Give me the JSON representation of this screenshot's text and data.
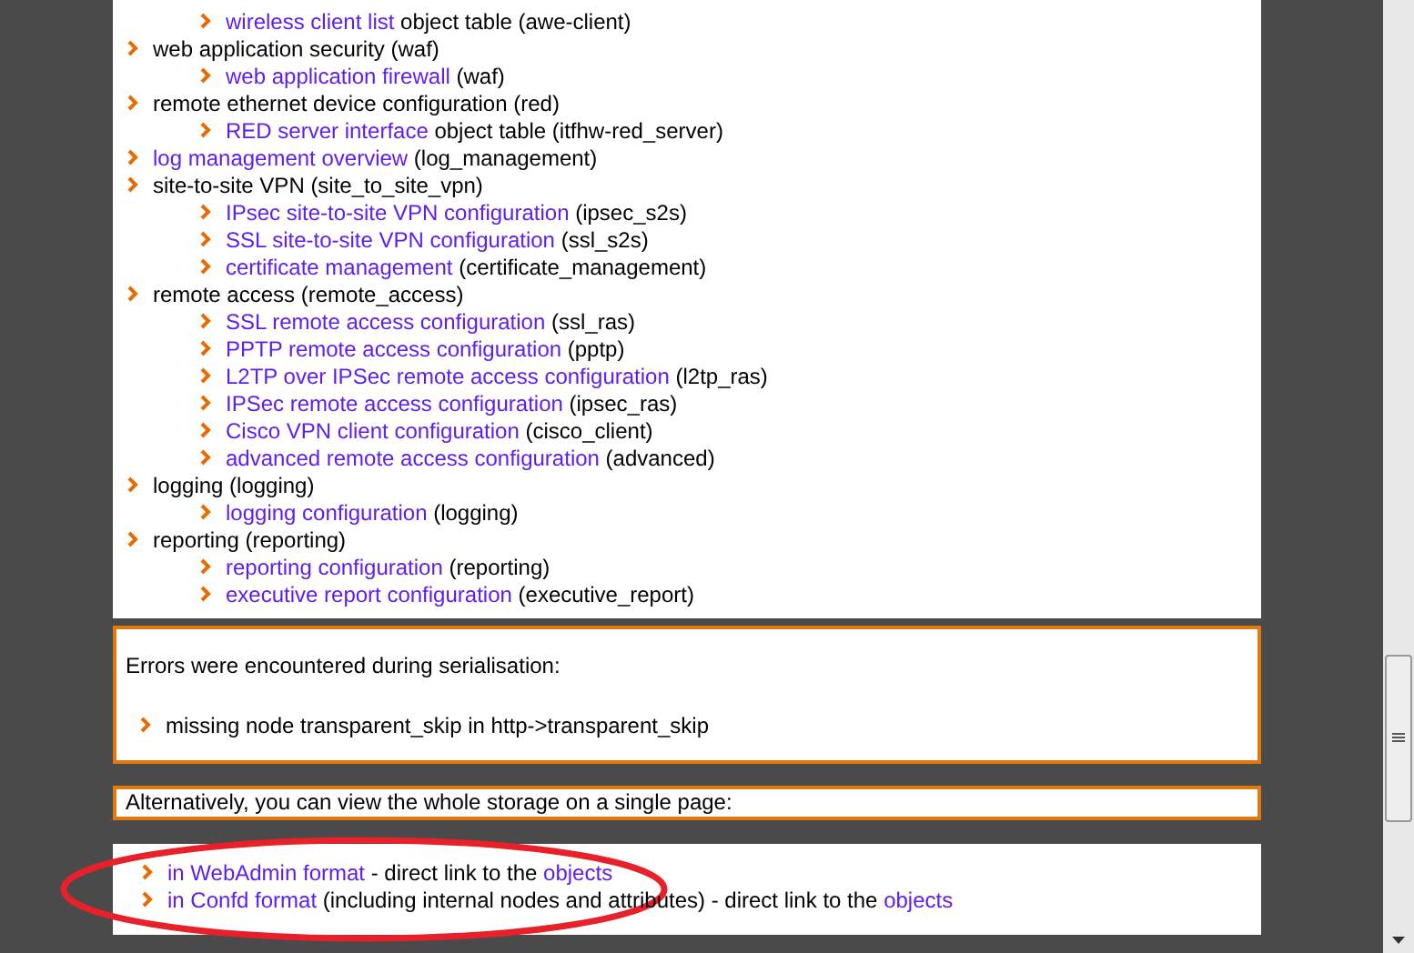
{
  "tree_continued": [
    {
      "parts": [
        {
          "kind": "link",
          "text": "wireless client list"
        },
        {
          "kind": "plain",
          "text": " object table (awe-client)"
        }
      ]
    }
  ],
  "tree": [
    {
      "parts": [
        {
          "kind": "plain",
          "text": "web application security (waf)"
        }
      ],
      "children": [
        {
          "parts": [
            {
              "kind": "link",
              "text": "web application firewall"
            },
            {
              "kind": "plain",
              "text": " (waf)"
            }
          ]
        }
      ]
    },
    {
      "parts": [
        {
          "kind": "plain",
          "text": "remote ethernet device configuration (red)"
        }
      ],
      "children": [
        {
          "parts": [
            {
              "kind": "link",
              "text": "RED server interface"
            },
            {
              "kind": "plain",
              "text": " object table (itfhw-red_server)"
            }
          ]
        }
      ]
    },
    {
      "parts": [
        {
          "kind": "link",
          "text": "log management overview"
        },
        {
          "kind": "plain",
          "text": " (log_management)"
        }
      ]
    },
    {
      "parts": [
        {
          "kind": "plain",
          "text": "site-to-site VPN (site_to_site_vpn)"
        }
      ],
      "children": [
        {
          "parts": [
            {
              "kind": "link",
              "text": "IPsec site-to-site VPN configuration"
            },
            {
              "kind": "plain",
              "text": " (ipsec_s2s)"
            }
          ]
        },
        {
          "parts": [
            {
              "kind": "link",
              "text": "SSL site-to-site VPN configuration"
            },
            {
              "kind": "plain",
              "text": " (ssl_s2s)"
            }
          ]
        },
        {
          "parts": [
            {
              "kind": "link",
              "text": "certificate management"
            },
            {
              "kind": "plain",
              "text": " (certificate_management)"
            }
          ]
        }
      ]
    },
    {
      "parts": [
        {
          "kind": "plain",
          "text": "remote access (remote_access)"
        }
      ],
      "children": [
        {
          "parts": [
            {
              "kind": "link",
              "text": "SSL remote access configuration"
            },
            {
              "kind": "plain",
              "text": " (ssl_ras)"
            }
          ]
        },
        {
          "parts": [
            {
              "kind": "link",
              "text": "PPTP remote access configuration"
            },
            {
              "kind": "plain",
              "text": " (pptp)"
            }
          ]
        },
        {
          "parts": [
            {
              "kind": "link",
              "text": "L2TP over IPSec remote access configuration"
            },
            {
              "kind": "plain",
              "text": " (l2tp_ras)"
            }
          ]
        },
        {
          "parts": [
            {
              "kind": "link",
              "text": "IPSec remote access configuration"
            },
            {
              "kind": "plain",
              "text": " (ipsec_ras)"
            }
          ]
        },
        {
          "parts": [
            {
              "kind": "link",
              "text": "Cisco VPN client configuration"
            },
            {
              "kind": "plain",
              "text": " (cisco_client)"
            }
          ]
        },
        {
          "parts": [
            {
              "kind": "link",
              "text": "advanced remote access configuration"
            },
            {
              "kind": "plain",
              "text": " (advanced)"
            }
          ]
        }
      ]
    },
    {
      "parts": [
        {
          "kind": "plain",
          "text": "logging (logging)"
        }
      ],
      "children": [
        {
          "parts": [
            {
              "kind": "link",
              "text": "logging configuration"
            },
            {
              "kind": "plain",
              "text": " (logging)"
            }
          ]
        }
      ]
    },
    {
      "parts": [
        {
          "kind": "plain",
          "text": "reporting (reporting)"
        }
      ],
      "children": [
        {
          "parts": [
            {
              "kind": "link",
              "text": "reporting configuration"
            },
            {
              "kind": "plain",
              "text": " (reporting)"
            }
          ]
        },
        {
          "parts": [
            {
              "kind": "link",
              "text": "executive report configuration"
            },
            {
              "kind": "plain",
              "text": " (executive_report)"
            }
          ]
        }
      ]
    }
  ],
  "errors": {
    "heading": "Errors were encountered during serialisation:",
    "items": [
      "missing node transparent_skip in http->transparent_skip"
    ]
  },
  "alternatives": {
    "intro": "Alternatively, you can view the whole storage on a single page:",
    "links": [
      {
        "parts": [
          {
            "kind": "link",
            "text": "in WebAdmin format"
          },
          {
            "kind": "plain",
            "text": " - direct link to the "
          },
          {
            "kind": "link",
            "text": "objects"
          }
        ]
      },
      {
        "parts": [
          {
            "kind": "link",
            "text": "in Confd format"
          },
          {
            "kind": "plain",
            "text": " (including internal nodes and attributes) - direct link to the "
          },
          {
            "kind": "link",
            "text": "objects"
          }
        ]
      }
    ]
  }
}
